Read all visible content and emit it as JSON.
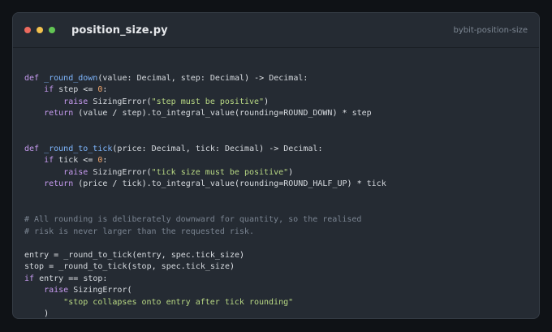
{
  "window": {
    "filename": "position_size.py",
    "repo": "bybit-position-size"
  },
  "code_lines": [
    "",
    "def _round_down(value: Decimal, step: Decimal) -> Decimal:",
    "    if step <= 0:",
    "        raise SizingError(\"step must be positive\")",
    "    return (value / step).to_integral_value(rounding=ROUND_DOWN) * step",
    "",
    "",
    "def _round_to_tick(price: Decimal, tick: Decimal) -> Decimal:",
    "    if tick <= 0:",
    "        raise SizingError(\"tick size must be positive\")",
    "    return (price / tick).to_integral_value(rounding=ROUND_HALF_UP) * tick",
    "",
    "",
    "# All rounding is deliberately downward for quantity, so the realised",
    "# risk is never larger than the requested risk.",
    "",
    "entry = _round_to_tick(entry, spec.tick_size)",
    "stop = _round_to_tick(stop, spec.tick_size)",
    "if entry == stop:",
    "    raise SizingError(",
    "        \"stop collapses onto entry after tick rounding\"",
    "    )"
  ],
  "colors": {
    "keyword": "#c79bf0",
    "function": "#7fb7ff",
    "string": "#b9d984",
    "number": "#f3a66b",
    "comment": "#7a8491",
    "background": "#252b33"
  }
}
